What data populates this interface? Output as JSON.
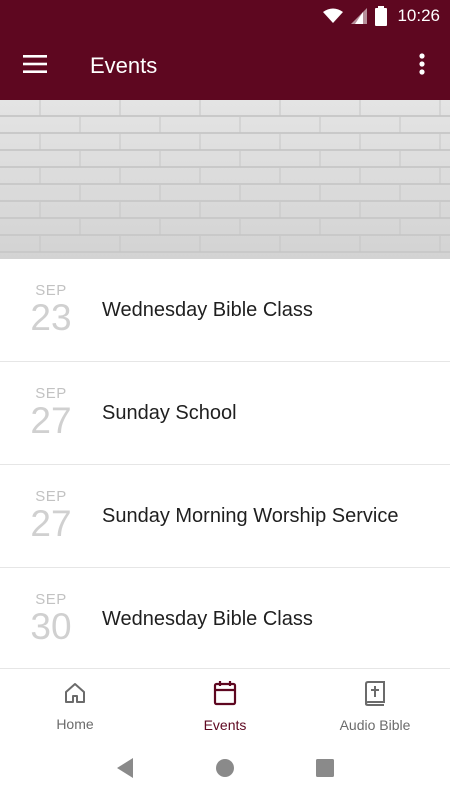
{
  "status_bar": {
    "time": "10:26",
    "icons": [
      "wifi-icon",
      "cell-signal-icon",
      "battery-icon"
    ]
  },
  "app_bar": {
    "title": "Events",
    "menu_icon": "menu-icon",
    "more_icon": "more-vert-icon"
  },
  "colors": {
    "brand": "#5e0720",
    "text": "#1f1f1f",
    "muted": "#c2c2c2"
  },
  "events": [
    {
      "month": "SEP",
      "day": "23",
      "title": "Wednesday Bible Class"
    },
    {
      "month": "SEP",
      "day": "27",
      "title": "Sunday School"
    },
    {
      "month": "SEP",
      "day": "27",
      "title": "Sunday Morning Worship Service"
    },
    {
      "month": "SEP",
      "day": "30",
      "title": "Wednesday Bible Class"
    }
  ],
  "bottom_nav": {
    "items": [
      {
        "label": "Home",
        "icon": "home-icon",
        "active": false
      },
      {
        "label": "Events",
        "icon": "calendar-icon",
        "active": true
      },
      {
        "label": "Audio Bible",
        "icon": "bible-icon",
        "active": false
      }
    ]
  },
  "system_nav": {
    "icons": [
      "back-icon",
      "home-circle-icon",
      "recents-icon"
    ]
  }
}
